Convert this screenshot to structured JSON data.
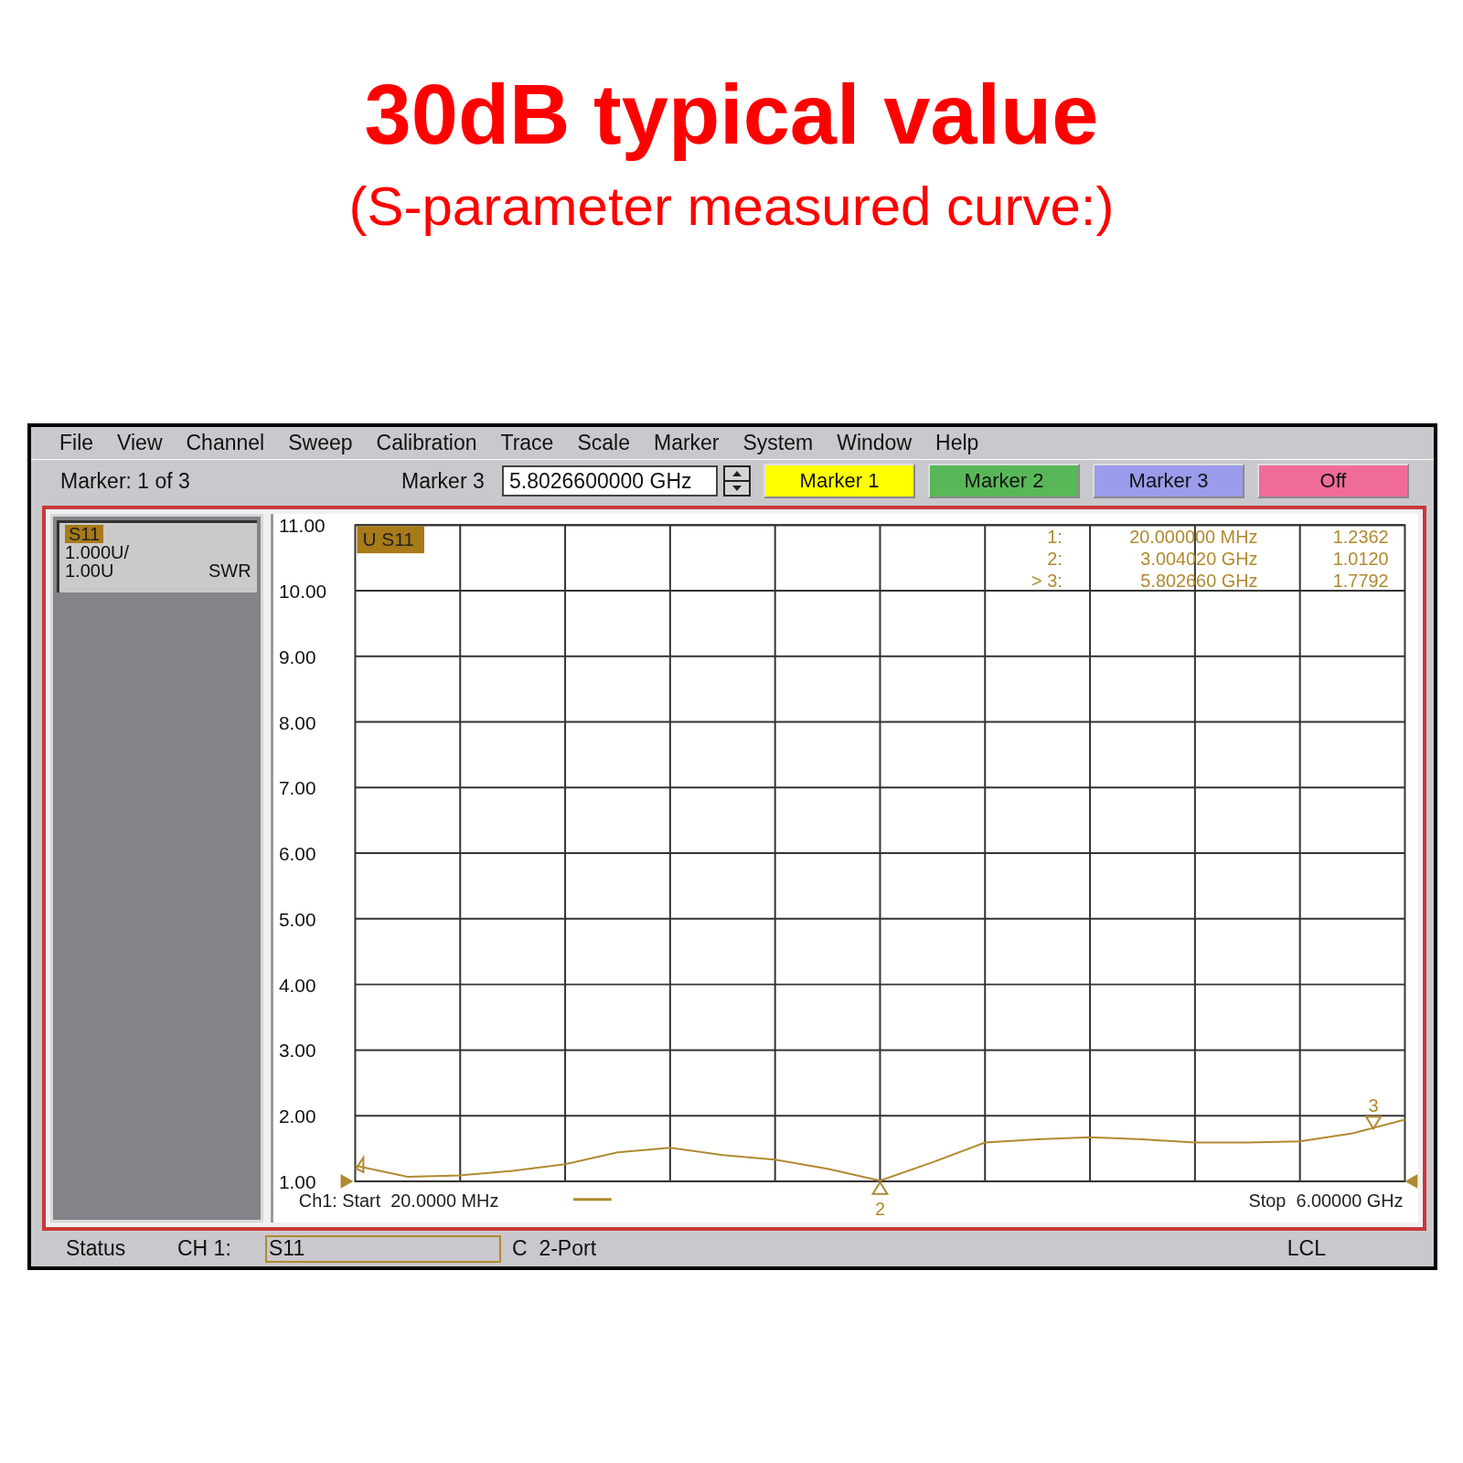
{
  "headline": {
    "title": "30dB typical value",
    "subtitle": "(S-parameter measured curve:)"
  },
  "window": {
    "menu": [
      "File",
      "View",
      "Channel",
      "Sweep",
      "Calibration",
      "Trace",
      "Scale",
      "Marker",
      "System",
      "Window",
      "Help"
    ],
    "toolbar": {
      "marker_status": "Marker: 1 of 3",
      "field_label": "Marker 3",
      "field_value": "5.8026600000 GHz",
      "buttons": [
        {
          "label": "Marker 1",
          "color": "#ffff00"
        },
        {
          "label": "Marker 2",
          "color": "#58b858"
        },
        {
          "label": "Marker 3",
          "color": "#9c9cec"
        },
        {
          "label": "Off",
          "color": "#f06c98"
        }
      ]
    },
    "trace_panel": {
      "badge": "S11",
      "scale": "1.000U/",
      "reference": "1.00U",
      "format": "SWR"
    },
    "plot": {
      "trace_badge": "U S11",
      "marker_readout": [
        {
          "number": "1:",
          "frequency": "20.000000 MHz",
          "value": "1.2362"
        },
        {
          "number": "2:",
          "frequency": "3.004020 GHz",
          "value": "1.0120",
          "tag": "2"
        },
        {
          "number": "> 3:",
          "frequency": "5.802660 GHz",
          "value": "1.7792",
          "tag": "3"
        }
      ],
      "start_label": "Ch1: Start  20.0000 MHz",
      "stop_label": "Stop  6.00000 GHz",
      "chart_data": {
        "type": "line",
        "grid": true,
        "ylim": [
          1,
          11
        ],
        "yticks": [
          {
            "value": 11,
            "label": "11.00"
          },
          {
            "value": 10,
            "label": "10.00"
          },
          {
            "value": 9,
            "label": "9.00"
          },
          {
            "value": 8,
            "label": "8.00"
          },
          {
            "value": 7,
            "label": "7.00"
          },
          {
            "value": 6,
            "label": "6.00"
          },
          {
            "value": 5,
            "label": "5.00"
          },
          {
            "value": 4,
            "label": "4.00"
          },
          {
            "value": 3,
            "label": "3.00"
          },
          {
            "value": 2,
            "label": "2.00"
          },
          {
            "value": 1,
            "label": "1.00"
          }
        ],
        "categories": [
          null,
          null,
          null,
          null,
          null,
          null,
          null,
          null,
          null,
          null,
          null,
          null,
          null,
          null,
          null,
          null,
          null,
          null,
          null,
          null,
          null
        ],
        "series": [
          {
            "color": "#b08a30",
            "values": [
              1.24,
              1.07,
              1.09,
              1.16,
              1.26,
              1.44,
              1.51,
              1.4,
              1.33,
              1.19,
              1.01,
              1.29,
              1.59,
              1.64,
              1.67,
              1.64,
              1.59,
              1.59,
              1.61,
              1.73,
              1.94
            ]
          }
        ]
      }
    },
    "status_bar": {
      "label": "Status",
      "channel": "CH 1:",
      "parameter": "S11",
      "mode": "C  2-Port",
      "control": "LCL"
    }
  }
}
